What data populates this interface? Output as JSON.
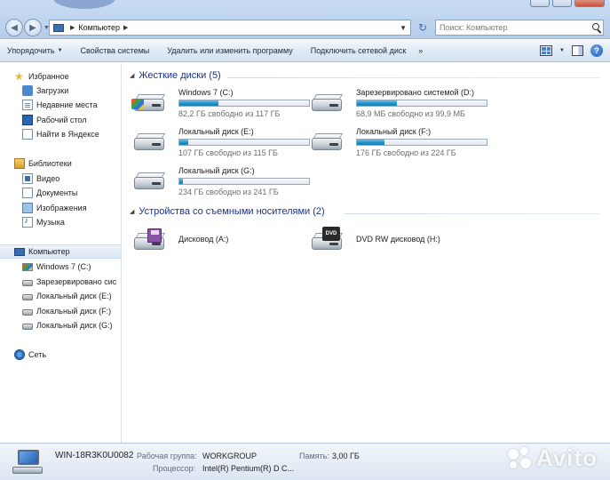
{
  "address": {
    "path": "Компьютер",
    "search_placeholder": "Поиск: Компьютер"
  },
  "toolbar": {
    "organize": "Упорядочить",
    "system_properties": "Свойства системы",
    "uninstall": "Удалить или изменить программу",
    "map_drive": "Подключить сетевой диск",
    "more": "»"
  },
  "sidebar": {
    "favorites": "Избранное",
    "downloads": "Загрузки",
    "recent": "Недавние места",
    "desktop": "Рабочий стол",
    "yandex": "Найти в Яндексе",
    "libraries": "Библиотеки",
    "video": "Видео",
    "documents": "Документы",
    "images": "Изображения",
    "music": "Музыка",
    "computer": "Компьютер",
    "drive_c": "Windows 7 (C:)",
    "drive_d": "Зарезервировано сис",
    "drive_e": "Локальный диск (E:)",
    "drive_f": "Локальный диск (F:)",
    "drive_g": "Локальный диск (G:)",
    "network": "Сеть"
  },
  "main": {
    "hard_drives_header": "Жесткие диски (5)",
    "removable_header": "Устройства со съемными носителями (2)",
    "drives": [
      {
        "name": "Windows 7 (C:)",
        "free": "82,2 ГБ свободно из 117 ГБ",
        "used_fraction": 0.3
      },
      {
        "name": "Зарезервировано системой (D:)",
        "free": "68,9 МБ свободно из 99,9 МБ",
        "used_fraction": 0.31
      },
      {
        "name": "Локальный диск (E:)",
        "free": "107 ГБ свободно из 115 ГБ",
        "used_fraction": 0.07
      },
      {
        "name": "Локальный диск (F:)",
        "free": "176 ГБ свободно из 224 ГБ",
        "used_fraction": 0.21
      },
      {
        "name": "Локальный диск (G:)",
        "free": "234 ГБ свободно из 241 ГБ",
        "used_fraction": 0.03
      }
    ],
    "removable": [
      {
        "name": "Дисковод (A:)"
      },
      {
        "name": "DVD RW дисковод (H:)"
      }
    ]
  },
  "details": {
    "computer_name": "WIN-18R3K0U0082",
    "workgroup_label": "Рабочая группа:",
    "workgroup_value": "WORKGROUP",
    "memory_label": "Память:",
    "memory_value": "3,00 ГБ",
    "cpu_label": "Процессор:",
    "cpu_value": "Intel(R) Pentium(R) D C..."
  },
  "watermark": "Avito",
  "dvd_badge": "DVD"
}
